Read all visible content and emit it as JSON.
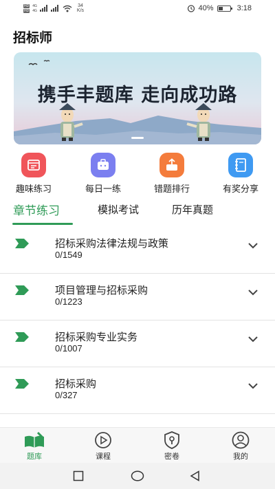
{
  "status_bar": {
    "sim1": "HD",
    "sim2": "HD",
    "net1": "4G",
    "net2": "4G",
    "speed_value": "34",
    "speed_unit": "K/s",
    "battery_percent": "40%",
    "battery_level": 0.4,
    "time": "3:18",
    "icons": [
      "signal-icon",
      "wifi-icon",
      "alarm-icon",
      "battery-icon"
    ]
  },
  "header": {
    "title": "招标师"
  },
  "banner": {
    "slogan": "携手丰题库 走向成功路",
    "colors": {
      "sky_top": "#c7e6ee",
      "sky_bottom": "#e9c9d6",
      "mountain": "#7f9bbd"
    }
  },
  "quick_actions": [
    {
      "label": "趣味练习",
      "icon": "calendar-icon",
      "color": "#f0555a"
    },
    {
      "label": "每日一练",
      "icon": "briefcase-icon",
      "color": "#7b7ff0"
    },
    {
      "label": "错题排行",
      "icon": "export-icon",
      "color": "#f47c3c"
    },
    {
      "label": "有奖分享",
      "icon": "notebook-icon",
      "color": "#3f9af2"
    }
  ],
  "tabs": [
    {
      "label": "章节练习",
      "active": true
    },
    {
      "label": "模拟考试",
      "active": false
    },
    {
      "label": "历年真题",
      "active": false
    }
  ],
  "chapters": [
    {
      "title": "招标采购法律法规与政策",
      "progress": "0/1549"
    },
    {
      "title": "项目管理与招标采购",
      "progress": "0/1223"
    },
    {
      "title": "招标采购专业实务",
      "progress": "0/1007"
    },
    {
      "title": "招标采购",
      "progress": "0/327"
    }
  ],
  "bottom_nav": [
    {
      "label": "题库",
      "icon": "book-icon",
      "active": true
    },
    {
      "label": "课程",
      "icon": "play-icon",
      "active": false
    },
    {
      "label": "密卷",
      "icon": "lock-shield-icon",
      "active": false
    },
    {
      "label": "我的",
      "icon": "user-icon",
      "active": false
    }
  ],
  "accent_color": "#2f9b57"
}
